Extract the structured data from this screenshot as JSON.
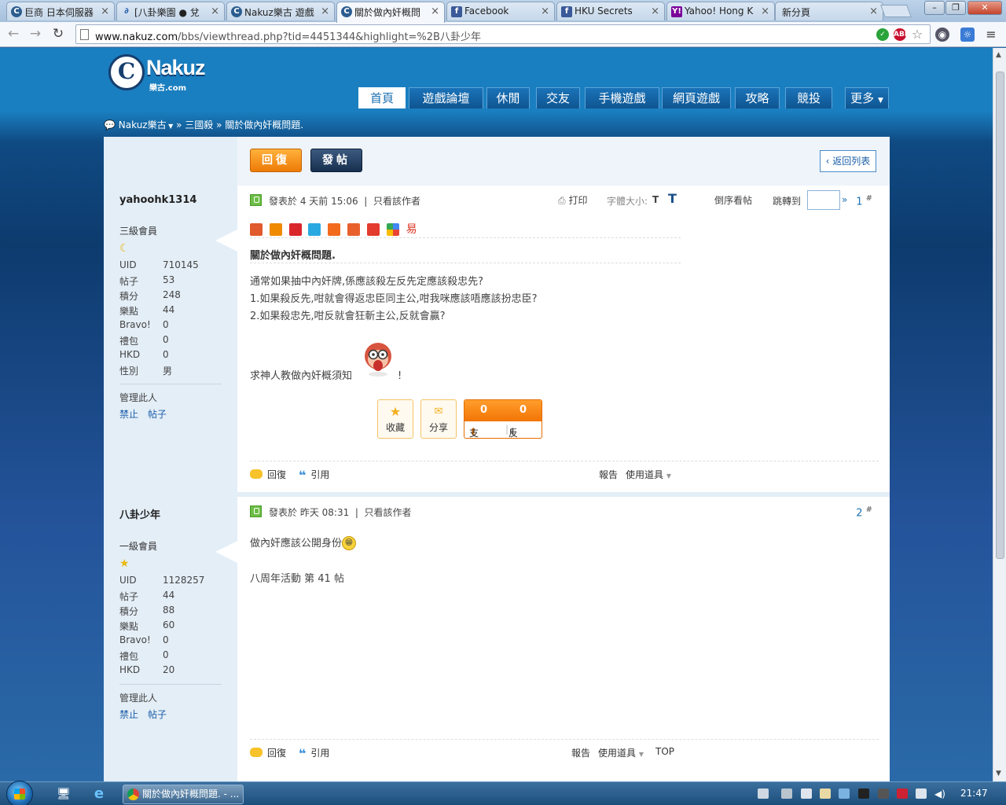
{
  "browser": {
    "tabs": [
      {
        "label": "巨商 日本伺服器",
        "icon": "nakuz-icon"
      },
      {
        "label": "[八卦樂園 ● 兌",
        "icon": "xianzhu-icon"
      },
      {
        "label": "Nakuz樂古 遊戲",
        "icon": "nakuz-icon"
      },
      {
        "label": "關於做內奸概問",
        "icon": "nakuz-icon",
        "active": true
      },
      {
        "label": "Facebook",
        "icon": "facebook-icon"
      },
      {
        "label": "HKU Secrets",
        "icon": "facebook-icon"
      },
      {
        "label": "Yahoo! Hong K",
        "icon": "yahoo-icon"
      },
      {
        "label": "新分頁",
        "icon": "none"
      }
    ],
    "url_host": "www.nakuz.com",
    "url_path": "/bbs/viewthread.php?tid=4451344&highlight=%2B八卦少年"
  },
  "site": {
    "logo_text": "Nakuz",
    "logo_sub": "樂古.com",
    "nav": [
      "首頁",
      "遊戲論壇",
      "休閒",
      "交友",
      "手機遊戲",
      "網頁遊戲",
      "攻略",
      "競投",
      "更多"
    ],
    "breadcrumb": {
      "home": "Nakuz樂古",
      "forum": "三國殺",
      "thread": "關於做內奸概問題."
    }
  },
  "toolbar": {
    "reply_label": "回復",
    "post_label": "發帖",
    "back_label": "返回列表"
  },
  "stat_labels": {
    "uid": "UID",
    "posts": "帖子",
    "points": "積分",
    "music": "樂點",
    "bravo": "Bravo!",
    "gift": "禮包",
    "hkd": "HKD",
    "gender": "性別"
  },
  "admin": {
    "label": "管理此人",
    "ban": "禁止",
    "posts": "帖子"
  },
  "posts": [
    {
      "floor": "1",
      "author": "yahoohk1314",
      "rank": "三級會員",
      "stats": {
        "uid": "710145",
        "posts": "53",
        "points": "248",
        "music": "44",
        "bravo": "0",
        "gift": "0",
        "hkd": "0",
        "gender": "男"
      },
      "posted": "發表於 4 天前 15:06",
      "only_author": "只看該作者",
      "tools": {
        "print": "打印",
        "font_size": "字體大小:",
        "small": "T",
        "large": "T",
        "reverse": "倒序看帖",
        "jump": "跳轉到",
        "jump_go": "»"
      },
      "title": "關於做內奸概問題.",
      "body": [
        "通常如果抽中內奸牌,係應該殺左反先定應該殺忠先?",
        "1.如果殺反先,咁就會得返忠臣同主公,咁我咪應該唔應該扮忠臣?",
        "2.如果殺忠先,咁反就會狂斬主公,反就會贏?"
      ],
      "ask": "求神人教做內奸概須知",
      "ask_end": "!",
      "actions": {
        "fav": "收藏",
        "share": "分享",
        "support_count": "0",
        "oppose_count": "0",
        "support": "支持",
        "oppose": "反對"
      },
      "footer": {
        "reply": "回復",
        "quote": "引用",
        "report": "報告",
        "tools": "使用道具"
      }
    },
    {
      "floor": "2",
      "author": "八卦少年",
      "rank": "一級會員",
      "stats": {
        "uid": "1128257",
        "posts": "44",
        "points": "88",
        "music": "60",
        "bravo": "0",
        "gift": "0",
        "hkd": "20"
      },
      "posted": "發表於 昨天 08:31",
      "only_author": "只看該作者",
      "body": [
        "做內奸應該公開身份"
      ],
      "event": "八周年活動 第 41 帖",
      "footer": {
        "reply": "回復",
        "quote": "引用",
        "report": "報告",
        "tools": "使用道具",
        "top": "TOP"
      }
    }
  ],
  "taskbar": {
    "task_label": "關於做內奸概問題. - ...",
    "clock": "21:47"
  }
}
